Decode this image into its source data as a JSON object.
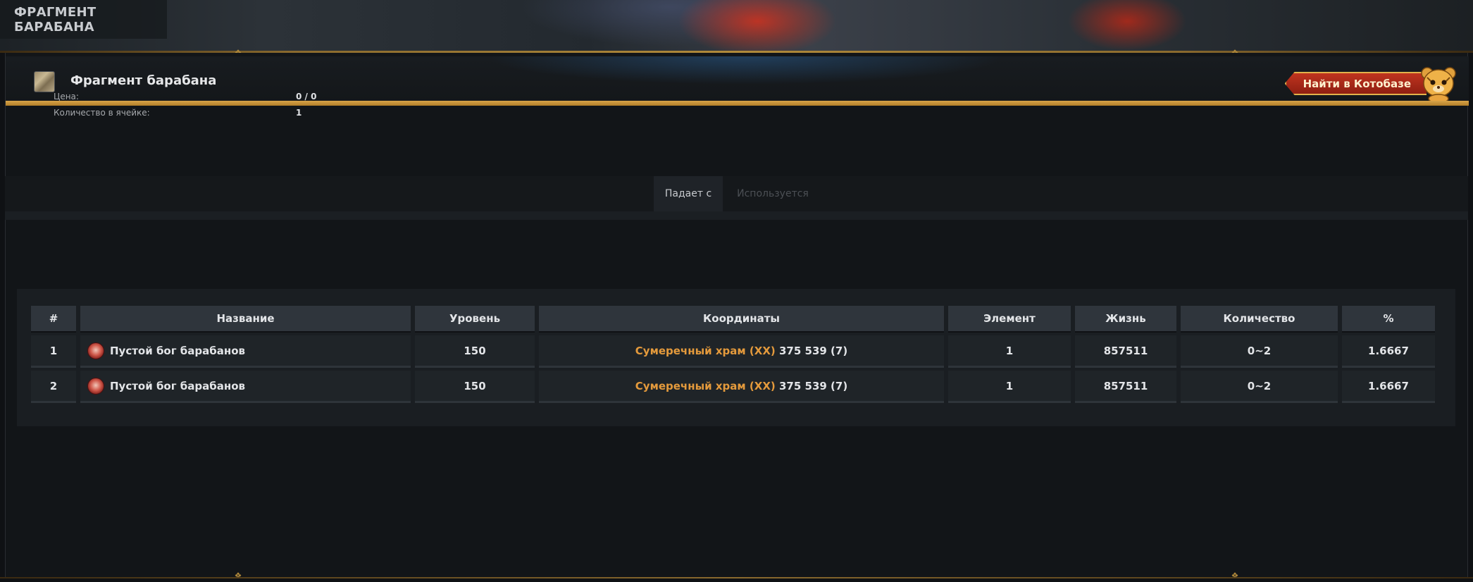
{
  "banner": {
    "title": "ФРАГМЕНТ БАРАБАНА"
  },
  "item": {
    "title": "Фрагмент барабана",
    "icon": "item-fragment-icon"
  },
  "find_button": {
    "label": "Найти в Котобазе",
    "mascot": "cat-mascot-icon"
  },
  "props": [
    {
      "label": "Цена:",
      "value": "0 / 0"
    },
    {
      "label": "Количество в ячейке:",
      "value": "1"
    }
  ],
  "tabs": [
    {
      "label": "Падает с",
      "active": true
    },
    {
      "label": "Используется",
      "active": false
    }
  ],
  "table": {
    "headers": [
      "#",
      "Название",
      "Уровень",
      "Координаты",
      "Элемент",
      "Жизнь",
      "Количество",
      "%"
    ],
    "rows": [
      {
        "num": "1",
        "name": "Пустой бог барабанов",
        "level": "150",
        "coord_link": "Сумеречный храм (XX)",
        "coord_rest": " 375 539 (7)",
        "element": "1",
        "hp": "857511",
        "qty": "0~2",
        "pct": "1.6667"
      },
      {
        "num": "2",
        "name": "Пустой бог барабанов",
        "level": "150",
        "coord_link": "Сумеречный храм (XX)",
        "coord_rest": " 375 539 (7)",
        "element": "1",
        "hp": "857511",
        "qty": "0~2",
        "pct": "1.6667"
      }
    ]
  },
  "colors": {
    "accent_gold": "#d8a448",
    "link_orange": "#e49a3c",
    "button_red": "#c0341f"
  }
}
